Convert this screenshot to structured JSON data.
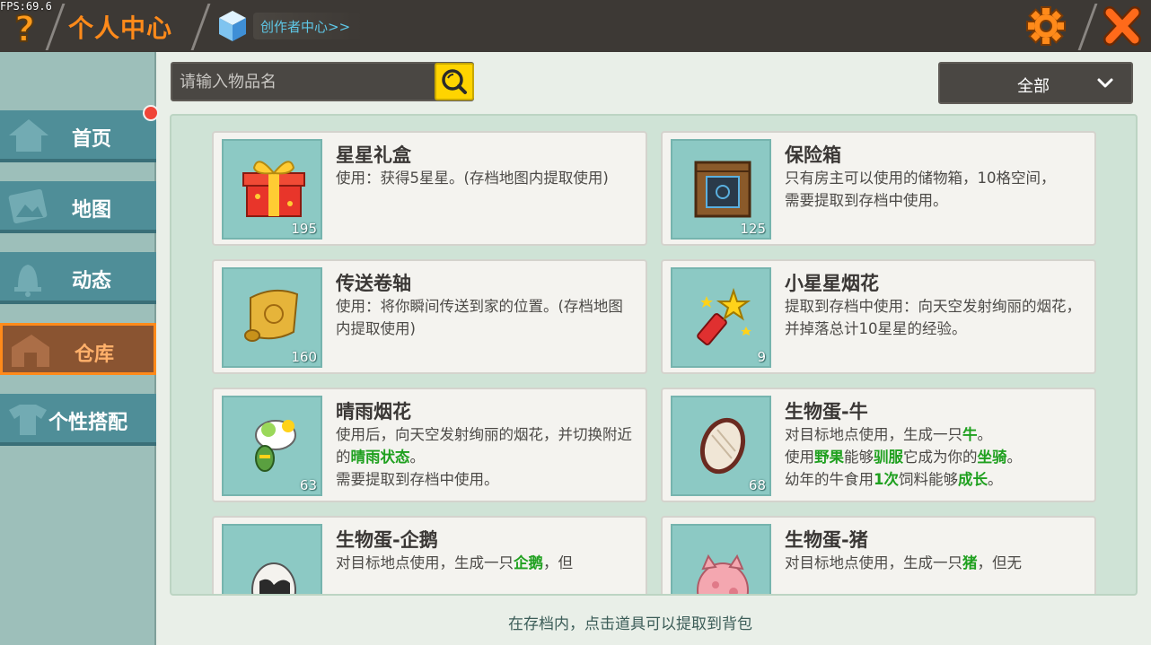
{
  "fps": "FPS:69.6",
  "header": {
    "title": "个人中心",
    "creator_link": "创作者中心>>",
    "help_icon": "question-icon",
    "settings_icon": "gear-icon",
    "close_icon": "close-icon",
    "accent_color": "#ff8a1a"
  },
  "sidebar": {
    "items": [
      {
        "label": "首页",
        "icon": "home-icon"
      },
      {
        "label": "地图",
        "icon": "map-icon"
      },
      {
        "label": "动态",
        "icon": "bell-icon"
      },
      {
        "label": "仓库",
        "icon": "warehouse-icon",
        "active": true
      },
      {
        "label": "个性搭配",
        "icon": "outfit-icon"
      }
    ]
  },
  "search": {
    "placeholder": "请输入物品名",
    "icon": "search-icon"
  },
  "filter": {
    "selected": "全部",
    "icon": "chevron-down-icon"
  },
  "items": [
    {
      "name": "星星礼盒",
      "count": "195",
      "desc": "使用：获得5星星。(存档地图内提取使用)"
    },
    {
      "name": "保险箱",
      "count": "125",
      "desc": "只有房主可以使用的储物箱，10格空间，\n需要提取到存档中使用。"
    },
    {
      "name": "传送卷轴",
      "count": "160",
      "desc": "使用：将你瞬间传送到家的位置。(存档地图内提取使用)"
    },
    {
      "name": "小星星烟花",
      "count": "9",
      "desc": "提取到存档中使用：向天空发射绚丽的烟花，并掉落总计10星星的经验。"
    },
    {
      "name": "晴雨烟花",
      "count": "63",
      "desc_parts": [
        "使用后，向天空发射绚丽的烟花，并切换附近的",
        "晴雨状态",
        "。",
        "需要提取到存档中使用。"
      ]
    },
    {
      "name": "生物蛋-牛",
      "count": "68",
      "desc_parts": [
        "对目标地点使用，生成一只",
        "牛",
        "。",
        "使用",
        "野果",
        "能够",
        "驯服",
        "它成为你的",
        "坐骑",
        "。",
        "幼年的牛食用",
        "1次",
        "饲料能够",
        "成长",
        "。"
      ]
    },
    {
      "name": "生物蛋-企鹅",
      "count": "",
      "desc_parts": [
        "对目标地点使用，生成一只",
        "企鹅",
        "，但"
      ]
    },
    {
      "name": "生物蛋-猪",
      "count": "",
      "desc_parts": [
        "对目标地点使用，生成一只",
        "猪",
        "，但无"
      ]
    }
  ],
  "footer_note": "在存档内，点击道具可以提取到背包"
}
